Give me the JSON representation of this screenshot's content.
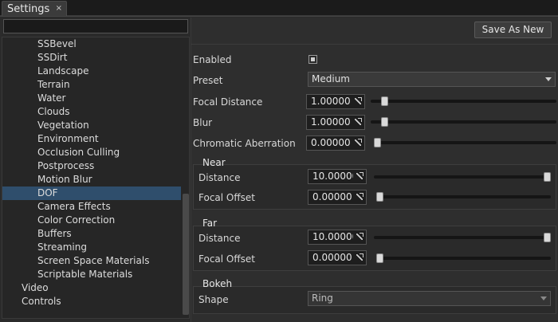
{
  "tab": {
    "title": "Settings",
    "close": "×"
  },
  "search": {
    "value": ""
  },
  "tree": {
    "items": [
      "SSBevel",
      "SSDirt",
      "Landscape",
      "Terrain",
      "Water",
      "Clouds",
      "Vegetation",
      "Environment",
      "Occlusion Culling",
      "Postprocess",
      "Motion Blur",
      "DOF",
      "Camera Effects",
      "Color Correction",
      "Buffers",
      "Streaming",
      "Screen Space Materials",
      "Scriptable Materials",
      "Video",
      "Controls"
    ],
    "selected": "DOF"
  },
  "toolbar": {
    "save_as_new": "Save As New"
  },
  "settings": {
    "enabled_label": "Enabled",
    "enabled": true,
    "preset_label": "Preset",
    "preset_value": "Medium",
    "focal_distance_label": "Focal Distance",
    "focal_distance_value": "1.00000",
    "focal_distance_slider": 0.06,
    "blur_label": "Blur",
    "blur_value": "1.00000",
    "blur_slider": 0.06,
    "chromatic_aberration_label": "Chromatic Aberration",
    "chromatic_aberration_value": "0.00000",
    "chromatic_aberration_slider": 0.0
  },
  "near": {
    "title": "Near",
    "distance_label": "Distance",
    "distance_value": "10.00000",
    "distance_slider": 1.0,
    "focal_offset_label": "Focal Offset",
    "focal_offset_value": "0.00000",
    "focal_offset_slider": 0.0
  },
  "far": {
    "title": "Far",
    "distance_label": "Distance",
    "distance_value": "10.00000",
    "distance_slider": 1.0,
    "focal_offset_label": "Focal Offset",
    "focal_offset_value": "0.00000",
    "focal_offset_slider": 0.0
  },
  "bokeh": {
    "title": "Bokeh",
    "shape_label": "Shape",
    "shape_value": "Ring"
  },
  "colors": {
    "selection": "#2f4e6c",
    "background": "#2e2e2e",
    "text": "#d8d8d8"
  }
}
